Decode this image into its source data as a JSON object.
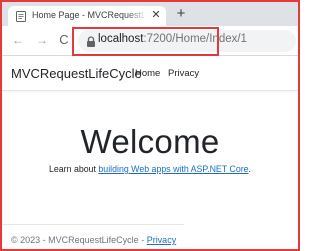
{
  "browser": {
    "tab_title": "Home Page - MVCRequestLifeCycle",
    "tab_close": "✕",
    "new_tab": "+",
    "url_host": "localhost",
    "url_path": ":7200/Home/Index/1",
    "nav_back": "←",
    "nav_forward": "→",
    "nav_reload": "C"
  },
  "navbar": {
    "brand": "MVCRequestLifeCycle",
    "links": [
      "Home",
      "Privacy"
    ]
  },
  "main": {
    "heading": "Welcome",
    "lead_prefix": "Learn about ",
    "lead_link": "building Web apps with ASP.NET Core",
    "lead_suffix": "."
  },
  "footer": {
    "text": "© 2023 - MVCRequestLifeCycle - ",
    "link": "Privacy"
  },
  "colors": {
    "highlight_border": "#e5393c",
    "link": "#1b6ec2",
    "tabstrip": "#dee1e6"
  },
  "icons": [
    "page-favicon-icon",
    "close-icon",
    "plus-icon",
    "back-arrow-icon",
    "forward-arrow-icon",
    "reload-icon",
    "lock-icon"
  ]
}
